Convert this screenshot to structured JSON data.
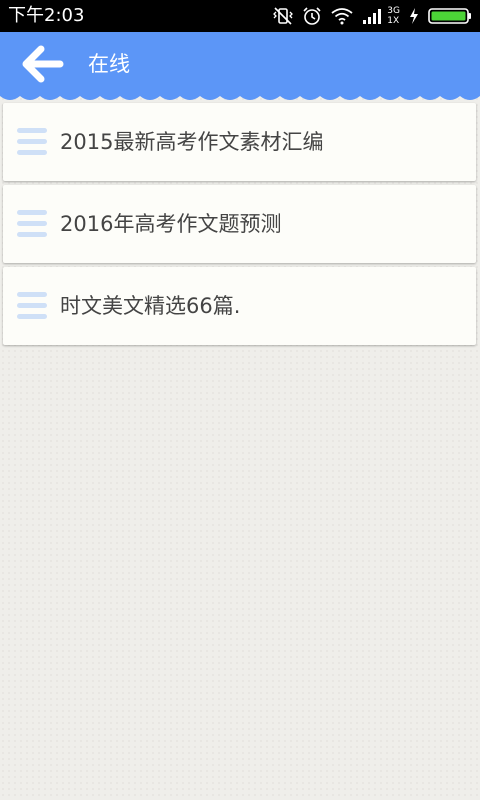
{
  "status_bar": {
    "time": "下午2:03",
    "network_type_top": "3G",
    "network_type_bottom": "1X",
    "icons": [
      "vibrate-off-icon",
      "alarm-icon",
      "wifi-icon",
      "signal-icon",
      "charging-icon",
      "battery-icon"
    ]
  },
  "header": {
    "title": "在线",
    "background_color": "#5c96f7",
    "back_icon": "arrow-left-icon"
  },
  "list": {
    "item_icon": "menu-lines-icon",
    "items": [
      {
        "label": "2015最新高考作文素材汇编"
      },
      {
        "label": "2016年高考作文题预测"
      },
      {
        "label": "时文美文精选66篇."
      }
    ]
  },
  "colors": {
    "accent": "#5c96f7",
    "card": "#fdfdf9",
    "page_background": "#efeeea",
    "list_icon": "#cfe0f7",
    "text": "#444444"
  }
}
